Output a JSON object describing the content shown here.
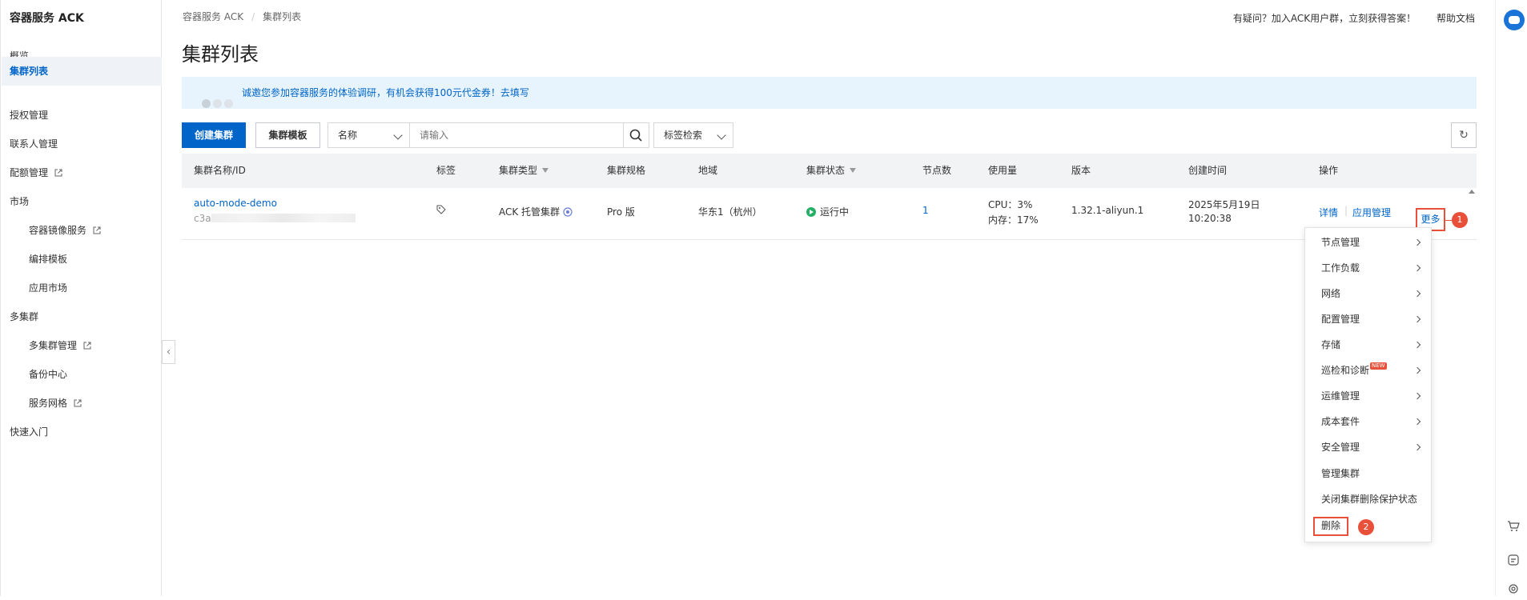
{
  "sidebar": {
    "title": "容器服务 ACK",
    "items": [
      {
        "label": "概览"
      },
      {
        "label": "集群列表"
      },
      {
        "label": "授权管理"
      },
      {
        "label": "联系人管理"
      },
      {
        "label": "配额管理"
      },
      {
        "label": "市场"
      },
      {
        "label": "容器镜像服务"
      },
      {
        "label": "编排模板"
      },
      {
        "label": "应用市场"
      },
      {
        "label": "多集群"
      },
      {
        "label": "多集群管理"
      },
      {
        "label": "备份中心"
      },
      {
        "label": "服务网格"
      },
      {
        "label": "快速入门"
      }
    ]
  },
  "breadcrumb": {
    "root": "容器服务 ACK",
    "sep": "/",
    "current": "集群列表"
  },
  "top_links": {
    "help_group": "有疑问？加入ACK用户群，立刻获得答案！",
    "docs": "帮助文档"
  },
  "page_title": "集群列表",
  "notice": "诚邀您参加容器服务的体验调研，有机会获得100元代金券！去填写",
  "toolbar": {
    "create": "创建集群",
    "template": "集群模板",
    "field_select": "名称",
    "search_placeholder": "请输入",
    "tag_search": "标签检索"
  },
  "table": {
    "headers": [
      "集群名称/ID",
      "标签",
      "集群类型",
      "集群规格",
      "地域",
      "集群状态",
      "节点数",
      "使用量",
      "版本",
      "创建时间",
      "操作"
    ],
    "row": {
      "name": "auto-mode-demo",
      "id_prefix": "c3a",
      "type": "ACK 托管集群",
      "spec": "Pro 版",
      "region": "华东1（杭州）",
      "status": "运行中",
      "nodes": "1",
      "cpu": "CPU：3%",
      "mem": "内存：17%",
      "version": "1.32.1-aliyun.1",
      "created_date": "2025年5月19日",
      "created_time": "10:20:38",
      "action_details": "详情",
      "action_apps": "应用管理",
      "action_more": "更多"
    }
  },
  "menu": {
    "items": [
      {
        "label": "节点管理"
      },
      {
        "label": "工作负载"
      },
      {
        "label": "网络"
      },
      {
        "label": "配置管理"
      },
      {
        "label": "存储"
      },
      {
        "label": "巡检和诊断",
        "tag": "NEW"
      },
      {
        "label": "运维管理"
      },
      {
        "label": "成本套件"
      },
      {
        "label": "安全管理"
      },
      {
        "label": "管理集群"
      },
      {
        "label": "关闭集群删除保护状态"
      },
      {
        "label": "删除"
      }
    ]
  },
  "callouts": [
    "1",
    "2"
  ],
  "colors": {
    "primary": "#0064c8",
    "highlight": "#e8503a",
    "running": "#23b066"
  }
}
